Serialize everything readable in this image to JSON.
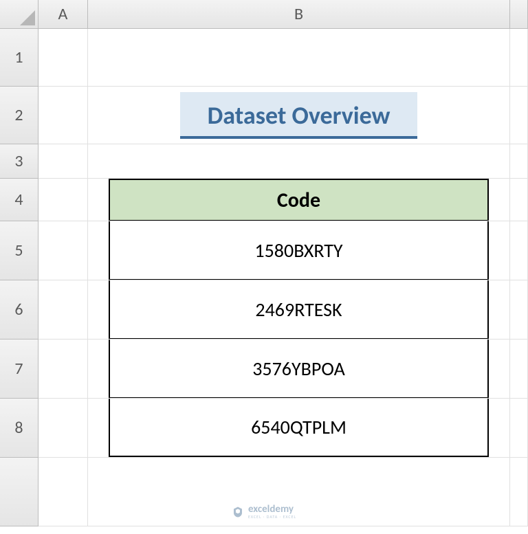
{
  "columns": {
    "A": "A",
    "B": "B"
  },
  "rows": {
    "r1": "1",
    "r2": "2",
    "r3": "3",
    "r4": "4",
    "r5": "5",
    "r6": "6",
    "r7": "7",
    "r8": "8"
  },
  "title": "Dataset Overview",
  "table": {
    "header": "Code",
    "rows": [
      "1580BXRTY",
      "2469RTESK",
      "3576YBPOA",
      "6540QTPLM"
    ]
  },
  "watermark": {
    "main": "exceldemy",
    "sub": "EXCEL · DATA · EXCEL"
  }
}
